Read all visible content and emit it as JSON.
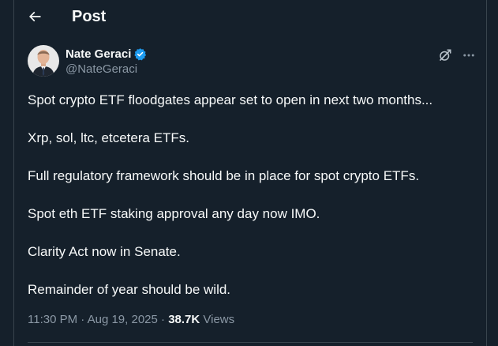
{
  "header": {
    "title": "Post"
  },
  "author": {
    "name": "Nate Geraci",
    "handle": "@NateGeraci"
  },
  "post": {
    "lines": [
      "Spot crypto ETF floodgates appear set to open in next two months...",
      "Xrp, sol, ltc, etcetera ETFs.",
      "Full regulatory framework should be in place for spot crypto ETFs.",
      "Spot eth ETF staking approval any day now IMO.",
      "Clarity Act now in Senate.",
      "Remainder of year should be wild."
    ]
  },
  "meta": {
    "time": "11:30 PM",
    "sep1": " · ",
    "date": "Aug 19, 2025",
    "sep2": " · ",
    "views_count": "38.7K",
    "views_label": " Views"
  },
  "colors": {
    "background": "#15202b",
    "text_primary": "#f7f9f9",
    "text_secondary": "#8b98a5",
    "verified_blue": "#1d9bf0",
    "border": "#38444d"
  },
  "icons": {
    "back": "arrow-left-icon",
    "verified": "verified-badge-icon",
    "grok": "grok-icon",
    "more": "more-horizontal-icon"
  }
}
